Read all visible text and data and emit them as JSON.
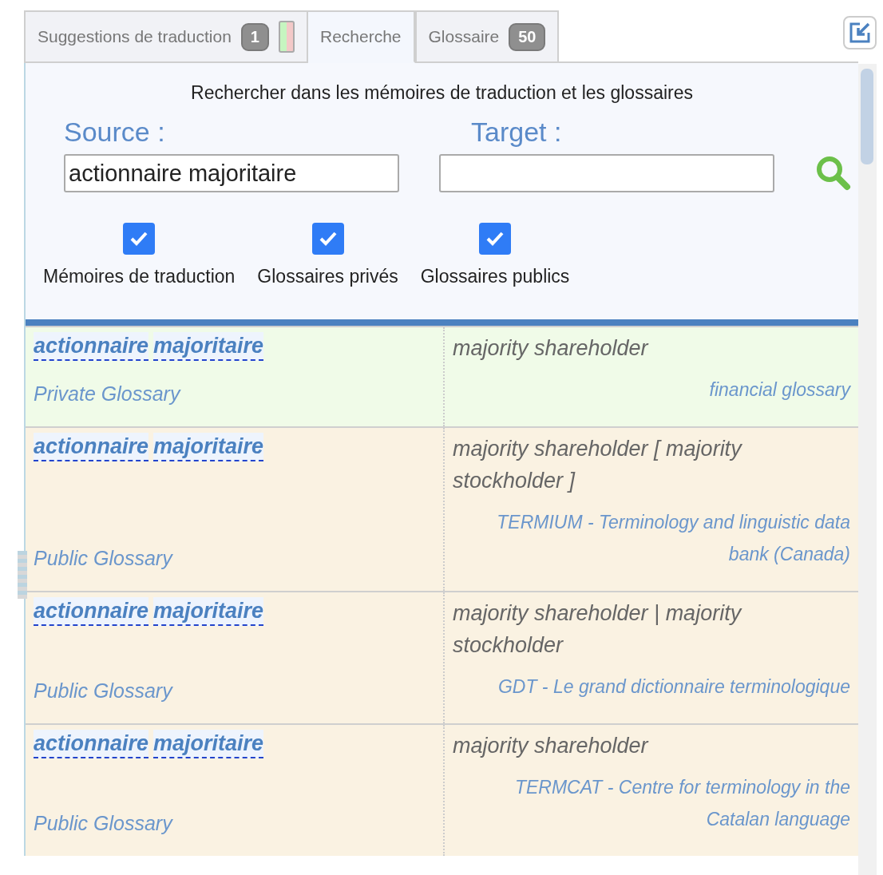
{
  "tabs": [
    {
      "label": "Suggestions de traduction",
      "badge": "1",
      "status_bar": true,
      "selected": false
    },
    {
      "label": "Recherche",
      "selected": true
    },
    {
      "label": "Glossaire",
      "badge": "50",
      "selected": false
    }
  ],
  "search": {
    "title": "Rechercher dans les mémoires de traduction et les glossaires",
    "source_label": "Source :",
    "source_value": "actionnaire majoritaire",
    "target_label": "Target :",
    "options": [
      {
        "label": "Mémoires de traduction",
        "checked": true
      },
      {
        "label": "Glossaires privés",
        "checked": true
      },
      {
        "label": "Glossaires publics",
        "checked": true
      }
    ]
  },
  "results": [
    {
      "kind": "private",
      "source_words": [
        "actionnaire",
        "majoritaire"
      ],
      "target": "majority shareholder",
      "type": "Private Glossary",
      "glossary": "financial glossary"
    },
    {
      "kind": "public",
      "source_words": [
        "actionnaire",
        "majoritaire"
      ],
      "target": "majority shareholder [ majority stockholder ]",
      "type": "Public Glossary",
      "glossary": "TERMIUM - Terminology and linguistic data bank (Canada)"
    },
    {
      "kind": "public",
      "source_words": [
        "actionnaire",
        "majoritaire"
      ],
      "target": "majority shareholder | majority stockholder",
      "type": "Public Glossary",
      "glossary": "GDT - Le grand dictionnaire terminologique"
    },
    {
      "kind": "public",
      "source_words": [
        "actionnaire",
        "majoritaire"
      ],
      "target": "majority shareholder",
      "type": "Public Glossary",
      "glossary": "TERMCAT - Centre for terminology in the Catalan language"
    }
  ]
}
